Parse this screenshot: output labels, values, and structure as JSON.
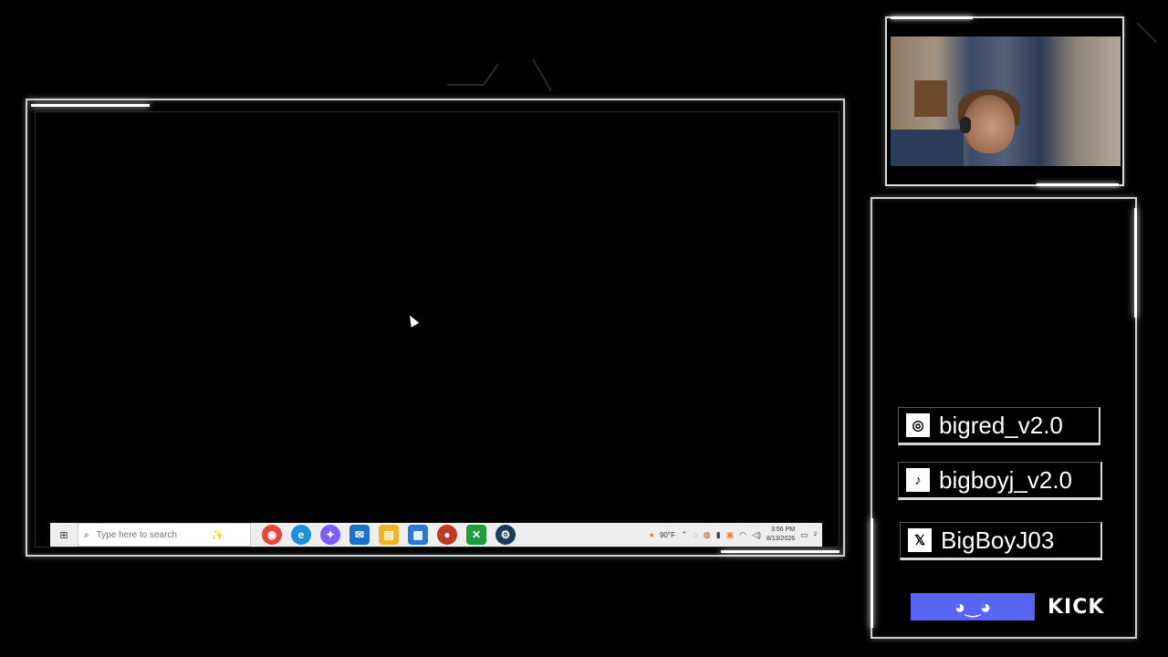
{
  "taskbar": {
    "search_placeholder": "Type here to search",
    "apps": [
      {
        "name": "chrome-icon",
        "glyph": "◉",
        "color": "#e8453c"
      },
      {
        "name": "edge-icon",
        "glyph": "e",
        "color": "#1f8fd8"
      },
      {
        "name": "copilot-icon",
        "glyph": "✦",
        "color": "#7b5cff"
      },
      {
        "name": "outlook-icon",
        "glyph": "✉",
        "color": "#1a73c8"
      },
      {
        "name": "file-explorer-icon",
        "glyph": "▤",
        "color": "#f0b429"
      },
      {
        "name": "store-icon",
        "glyph": "▦",
        "color": "#2b79d3"
      },
      {
        "name": "game-app-icon",
        "glyph": "●",
        "color": "#c0392b"
      },
      {
        "name": "xbox-icon",
        "glyph": "✕",
        "color": "#1e9e3e"
      },
      {
        "name": "steam-icon",
        "glyph": "⚙",
        "color": "#1b3a5c"
      }
    ],
    "weather": "90°F",
    "time": "3:56 PM",
    "date": "8/13/2026",
    "notification_count": "2"
  },
  "socials": {
    "instagram": {
      "icon": "instagram-icon",
      "handle": "bigred_v2.0"
    },
    "tiktok": {
      "icon": "tiktok-icon",
      "handle": "bigboyj_v2.0"
    },
    "x": {
      "icon": "x-icon",
      "handle": "BigBoyJ03"
    },
    "kick": {
      "label": "KICK"
    }
  },
  "colors": {
    "discord": "#5865f2",
    "frame_border": "#cfcfcf",
    "background": "#000000"
  }
}
